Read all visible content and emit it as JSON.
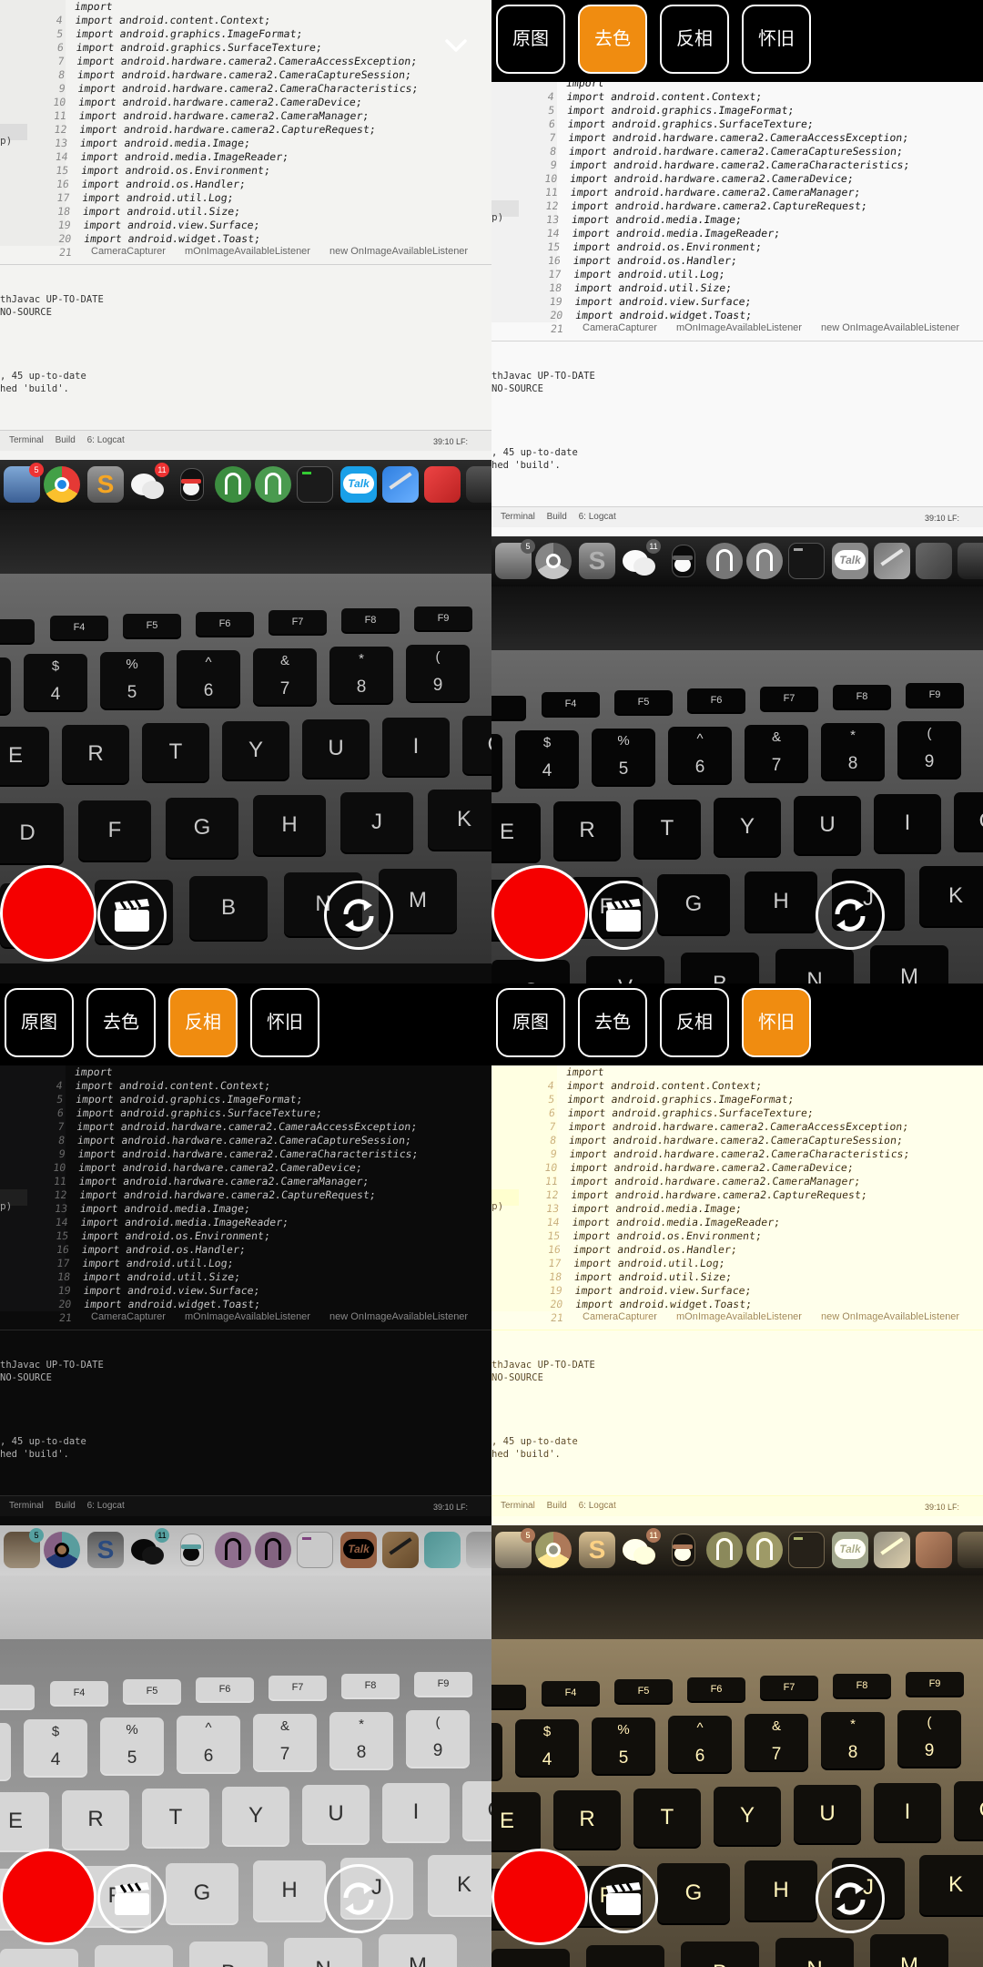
{
  "filters": [
    "原图",
    "去色",
    "反相",
    "怀旧"
  ],
  "panels": [
    {
      "id": "q1",
      "active": "",
      "show_bar": false
    },
    {
      "id": "q2",
      "active": "去色",
      "show_bar": true
    },
    {
      "id": "q3",
      "active": "反相",
      "show_bar": true
    },
    {
      "id": "q4",
      "active": "怀旧",
      "show_bar": true
    }
  ],
  "colors": {
    "accent": "#f08c10",
    "shutter": "#f50000"
  },
  "ide": {
    "code": [
      {
        "n": "",
        "text": "import"
      },
      {
        "n": "4",
        "text": "import android.content.Context;"
      },
      {
        "n": "5",
        "text": "import android.graphics.ImageFormat;"
      },
      {
        "n": "6",
        "text": "import android.graphics.SurfaceTexture;"
      },
      {
        "n": "7",
        "text": "import android.hardware.camera2.CameraAccessException;"
      },
      {
        "n": "8",
        "text": "import android.hardware.camera2.CameraCaptureSession;"
      },
      {
        "n": "9",
        "text": "import android.hardware.camera2.CameraCharacteristics;"
      },
      {
        "n": "10",
        "text": "import android.hardware.camera2.CameraDevice;"
      },
      {
        "n": "11",
        "text": "import android.hardware.camera2.CameraManager;"
      },
      {
        "n": "12",
        "text": "import android.hardware.camera2.CaptureRequest;"
      },
      {
        "n": "13",
        "text": "import android.media.Image;"
      },
      {
        "n": "14",
        "text": "import android.media.ImageReader;"
      },
      {
        "n": "15",
        "text": "import android.os.Environment;"
      },
      {
        "n": "16",
        "text": "import android.os.Handler;"
      },
      {
        "n": "17",
        "text": "import android.util.Log;"
      },
      {
        "n": "18",
        "text": "import android.util.Size;"
      },
      {
        "n": "19",
        "text": "import android.view.Surface;"
      },
      {
        "n": "20",
        "text": "import android.widget.Toast;"
      },
      {
        "n": "21",
        "text": ""
      }
    ],
    "side_text": "p)",
    "breadcrumb": [
      "CameraCapturer",
      "mOnImageAvailableListener",
      "new OnImageAvailableListener"
    ],
    "console": [
      "thJavac UP-TO-DATE",
      " NO-SOURCE",
      "",
      "",
      "",
      "",
      ", 45 up-to-date",
      "hed 'build'."
    ],
    "tool_windows": [
      "Terminal",
      "Build",
      "6: Logcat"
    ],
    "cursor_pos": "39:10  LF:"
  },
  "dock": {
    "badges": [
      "5",
      "11"
    ],
    "talk_label": "Talk"
  },
  "keyboard": {
    "fn_row": [
      "F4",
      "F5",
      "F6",
      "F7",
      "F8",
      "F9"
    ],
    "num_row": [
      {
        "top": "$",
        "bottom": "4"
      },
      {
        "top": "%",
        "bottom": "5"
      },
      {
        "top": "^",
        "bottom": "6"
      },
      {
        "top": "&",
        "bottom": "7"
      },
      {
        "top": "*",
        "bottom": "8"
      },
      {
        "top": "(",
        "bottom": "9"
      }
    ],
    "row2": [
      "E",
      "R",
      "T",
      "Y",
      "U",
      "I",
      "O"
    ],
    "row3": [
      "D",
      "F",
      "G",
      "H",
      "J",
      "K"
    ],
    "row4": [
      "C",
      "V",
      "B",
      "N",
      "M"
    ]
  },
  "icons": {
    "collapse": "chevron-down-icon",
    "video": "clapperboard-icon",
    "switch": "camera-switch-icon"
  }
}
